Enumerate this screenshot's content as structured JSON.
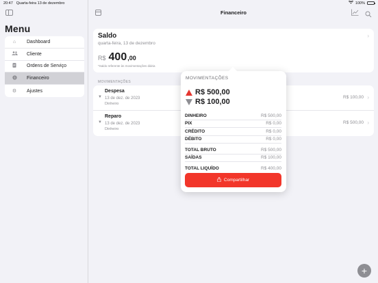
{
  "statusbar": {
    "time": "20:47",
    "date": "Quarta-feira 13 de dezembro",
    "battery": "100%"
  },
  "sidebar": {
    "title": "Menu",
    "items": [
      {
        "label": "Dashboard",
        "icon": "house-icon",
        "active": false
      },
      {
        "label": "Cliente",
        "icon": "people-icon",
        "active": false
      },
      {
        "label": "Ordens de Serviço",
        "icon": "document-icon",
        "active": false
      },
      {
        "label": "Financeiro",
        "icon": "money-icon",
        "active": true
      },
      {
        "label": "Ajustes",
        "icon": "gear-icon",
        "active": false
      }
    ]
  },
  "header": {
    "title": "Financeiro"
  },
  "saldo": {
    "title": "Saldo",
    "date": "quarta-feira, 13 de dezembro",
    "currency": "R$",
    "integer": "400",
    "decimal": ",00",
    "note": "*Saldo referente às movimentações diária"
  },
  "section": {
    "label": "MOVIMENTAÇÕES"
  },
  "transactions": [
    {
      "title": "Despesa",
      "date": "13 de dez. de 2023",
      "method": "Dinheiro",
      "value": "R$ 100,00",
      "direction": "down"
    },
    {
      "title": "Reparo",
      "date": "13 de dez. de 2023",
      "method": "Dinheiro",
      "value": "R$ 500,00",
      "direction": "down"
    }
  ],
  "popover": {
    "title": "MOVIMENTAÇÕES",
    "in_value": "R$ 500,00",
    "out_value": "R$ 100,00",
    "rows": [
      {
        "label": "DINHEIRO",
        "value": "R$ 500,00"
      },
      {
        "label": "PIX",
        "value": "R$ 0,00"
      },
      {
        "label": "CRÉDITO",
        "value": "R$ 0,00"
      },
      {
        "label": "DÉBITO",
        "value": "R$ 0,00"
      },
      {
        "label": "TOTAL BRUTO",
        "value": "R$ 500,00"
      },
      {
        "label": "SAÍDAS",
        "value": "R$ 100,00"
      },
      {
        "label": "TOTAL LIQUÍDO",
        "value": "R$ 400,00"
      }
    ],
    "share_label": "Compartilhar"
  },
  "colors": {
    "accent_red": "#f2362a",
    "up_arrow": "#e5362f",
    "gray": "#8e8e93"
  },
  "fab": {
    "label": "+"
  }
}
